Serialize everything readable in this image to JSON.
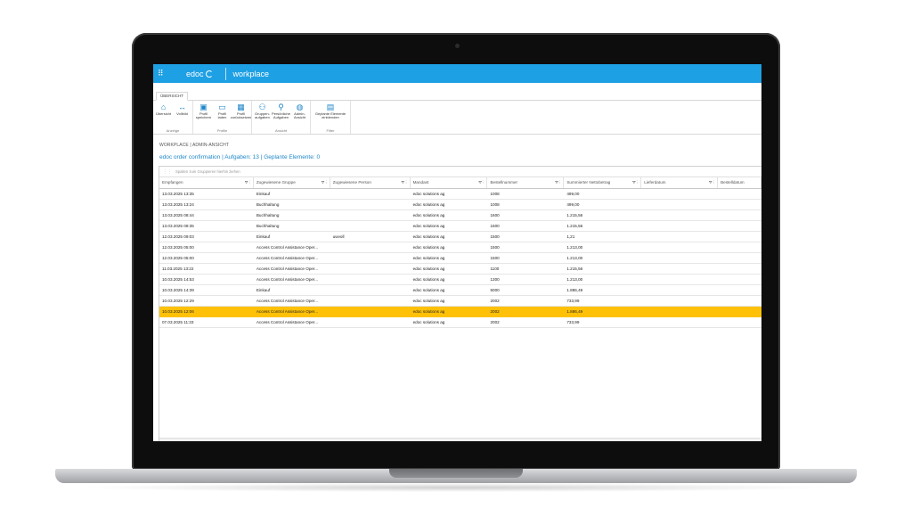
{
  "app": {
    "brand": "edoc",
    "title": "workplace",
    "tab": "ÜBERSICHT"
  },
  "ribbon": {
    "groups": [
      {
        "label": "Anzeige",
        "buttons": [
          {
            "label": "Übersicht",
            "icon": "home-icon"
          },
          {
            "label": "Vollbild",
            "icon": "expand-arrows-icon"
          }
        ]
      },
      {
        "label": "Profile",
        "buttons": [
          {
            "label": "Profil speichern",
            "icon": "save-icon"
          },
          {
            "label": "Profil laden",
            "icon": "document-icon"
          },
          {
            "label": "Profil zurücksetzen",
            "icon": "table-reset-icon"
          }
        ]
      },
      {
        "label": "Ansicht",
        "buttons": [
          {
            "label": "Gruppen-aufgaben",
            "icon": "group-icon"
          },
          {
            "label": "Persönliche Aufgaben",
            "icon": "person-icon"
          },
          {
            "label": "Admin-Ansicht",
            "icon": "globe-icon"
          }
        ]
      },
      {
        "label": "Filter",
        "buttons": [
          {
            "label": "Geplante Elemente einblenden",
            "icon": "calendar-filter-icon"
          }
        ]
      }
    ]
  },
  "breadcrumb": "WORKPLACE | ADMIN-ANSICHT",
  "subtitle": "edoc order confirmation | Aufgaben: 13 | Geplante Elemente: 0",
  "groupbar_hint": "Spalten zum Gruppieren hierhin ziehen",
  "columns": [
    "Empfangen",
    "Zugewiesene Gruppe",
    "Zugewiesene Person",
    "Mandant",
    "Bestellnummer",
    "Summierter Nettobetrag",
    "Lieferdatum",
    "Bestelldatum"
  ],
  "rows": [
    [
      "13.03.2025 13:35",
      "Einkauf",
      "",
      "edoc solutions ag",
      "1008",
      "499,00",
      "",
      ""
    ],
    [
      "13.03.2025 13:24",
      "Buchhaltung",
      "",
      "edoc solutions ag",
      "1008",
      "499,00",
      "",
      ""
    ],
    [
      "13.03.2025 08:44",
      "Buchhaltung",
      "",
      "edoc solutions ag",
      "1600",
      "1.215,56",
      "",
      ""
    ],
    [
      "13.03.2025 08:35",
      "Buchhaltung",
      "",
      "edoc solutions ag",
      "1600",
      "1.215,56",
      "",
      ""
    ],
    [
      "12.03.2025 09:03",
      "Einkauf",
      "uwvoll",
      "edoc solutions ag",
      "1500",
      "1,21",
      "",
      ""
    ],
    [
      "12.03.2025 05:00",
      "Access Control Assistance Oper...",
      "",
      "edoc solutions ag",
      "1500",
      "1.213,00",
      "",
      ""
    ],
    [
      "12.03.2025 05:00",
      "Access Control Assistance Oper...",
      "",
      "edoc solutions ag",
      "1500",
      "1.213,00",
      "",
      ""
    ],
    [
      "11.03.2025 13:22",
      "Access Control Assistance Oper...",
      "",
      "edoc solutions ag",
      "1100",
      "1.215,56",
      "",
      ""
    ],
    [
      "10.03.2025 14:53",
      "Access Control Assistance Oper...",
      "",
      "edoc solutions ag",
      "1300",
      "1.213,00",
      "",
      ""
    ],
    [
      "10.03.2025 14:39",
      "Einkauf",
      "",
      "edoc solutions ag",
      "5000",
      "1.886,49",
      "",
      ""
    ],
    [
      "10.03.2025 12:29",
      "Access Control Assistance Oper...",
      "",
      "edoc solutions ag",
      "2002",
      "733,99",
      "",
      ""
    ],
    [
      "10.03.2025 12:06",
      "Access Control Assistance Oper...",
      "",
      "edoc solutions ag",
      "2002",
      "1.886,49",
      "",
      ""
    ],
    [
      "07.03.2025 11:33",
      "Access Control Assistance Oper...",
      "",
      "edoc solutions ag",
      "2002",
      "733,99",
      "",
      ""
    ]
  ],
  "selected_row": 11,
  "colors": {
    "accent": "#1ea0e4",
    "selection": "#ffc107",
    "link": "#1e86c8"
  }
}
